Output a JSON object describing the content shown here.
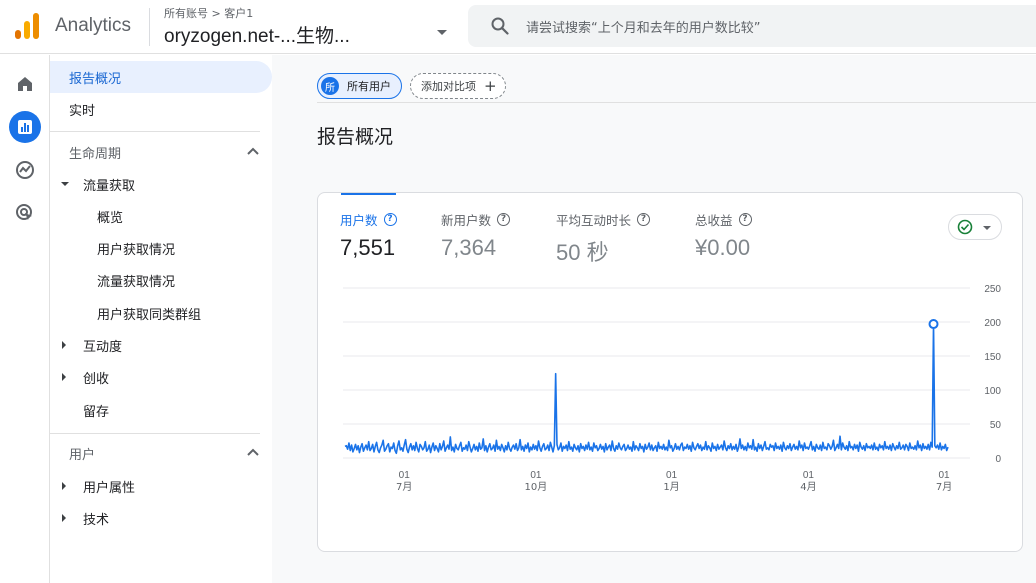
{
  "header": {
    "app_name": "Analytics",
    "breadcrumb": "所有账号 > 客户1",
    "property": "oryzogen.net-...生物...",
    "search_placeholder": "请尝试搜索“上个月和去年的用户数比较”"
  },
  "rail": {
    "items": [
      {
        "icon": "home-icon",
        "active": false
      },
      {
        "icon": "reports-icon",
        "active": true
      },
      {
        "icon": "explore-icon",
        "active": false
      },
      {
        "icon": "advertising-icon",
        "active": false
      }
    ]
  },
  "nav": {
    "overview": "报告概况",
    "realtime": "实时",
    "lifecycle": "生命周期",
    "acquisition": "流量获取",
    "acq_overview": "概览",
    "user_acquisition": "用户获取情况",
    "traffic_acquisition": "流量获取情况",
    "cohort": "用户获取同类群组",
    "engagement": "互动度",
    "monetization": "创收",
    "retention": "留存",
    "user": "用户",
    "user_attributes": "用户属性",
    "tech": "技术"
  },
  "main": {
    "chip_all_avatar": "所",
    "chip_all": "所有用户",
    "chip_add": "添加对比项",
    "chip_add_icon": "+",
    "page_title": "报告概况",
    "help_glyph": "?",
    "metrics": [
      {
        "label": "用户数",
        "value": "7,551"
      },
      {
        "label": "新用户数",
        "value": "7,364"
      },
      {
        "label": "平均互动时长",
        "value": "50 秒"
      },
      {
        "label": "总收益",
        "value": "¥0.00"
      }
    ]
  },
  "colors": {
    "accent": "#1a73e8",
    "line": "#1a73e8",
    "check": "#188038"
  },
  "chart_data": {
    "type": "line",
    "y_ticks": [
      "250",
      "200",
      "150",
      "100",
      "50",
      "0"
    ],
    "ylim": [
      0,
      250
    ],
    "x_ticks": [
      {
        "day": "01",
        "month": "7月"
      },
      {
        "day": "01",
        "month": "10月"
      },
      {
        "day": "01",
        "month": "1月"
      },
      {
        "day": "01",
        "month": "4月"
      },
      {
        "day": "01",
        "month": "7月"
      }
    ],
    "series": [
      {
        "values": [
          17,
          18,
          13,
          22,
          11,
          19,
          9,
          14,
          20,
          12,
          18,
          8,
          16,
          21,
          10,
          15,
          19,
          12,
          24,
          11,
          14,
          20,
          9,
          17,
          23,
          12,
          8,
          15,
          19,
          26,
          10,
          13,
          18,
          21,
          9,
          16,
          14,
          22,
          11,
          7,
          18,
          25,
          12,
          15,
          10,
          19,
          27,
          13,
          8,
          16,
          21,
          12,
          18,
          11,
          23,
          14,
          9,
          20,
          17,
          12,
          15,
          24,
          10,
          13,
          19,
          8,
          16,
          22,
          11,
          18,
          14,
          9,
          21,
          12,
          17,
          25,
          10,
          15,
          19,
          13,
          31,
          11,
          16,
          9,
          20,
          14,
          12,
          18,
          23,
          10,
          15,
          13,
          19,
          11,
          24,
          16,
          9,
          14,
          20,
          12,
          17,
          10,
          22,
          13,
          15,
          28,
          11,
          18,
          9,
          16,
          21,
          12,
          14,
          19,
          10,
          26,
          13,
          17,
          11,
          20,
          15,
          9,
          18,
          12,
          23,
          14,
          10,
          16,
          19,
          13,
          21,
          11,
          15,
          27,
          12,
          17,
          10,
          19,
          14,
          22,
          9,
          16,
          12,
          20,
          13,
          18,
          11,
          25,
          15,
          10,
          17,
          21,
          12,
          14,
          19,
          11,
          23,
          16,
          9,
          18,
          13,
          20,
          12,
          15,
          22,
          10,
          17,
          14,
          19,
          11,
          24,
          13,
          16,
          10,
          20,
          15,
          12,
          18,
          9,
          21,
          14,
          17,
          11,
          19,
          13,
          23,
          12,
          16,
          10,
          22,
          15,
          18,
          11,
          14,
          20,
          13,
          17,
          9,
          21,
          12,
          16,
          19,
          11,
          25,
          14,
          10,
          18,
          13,
          22,
          15,
          12,
          17,
          20,
          11,
          14,
          19,
          13,
          16,
          10,
          24,
          12,
          18,
          15,
          11,
          21,
          14,
          17,
          9,
          20,
          13,
          16,
          22,
          12,
          19,
          11,
          15,
          18,
          10,
          23,
          14,
          17,
          13,
          20,
          12,
          16,
          11,
          26,
          15,
          18,
          10,
          14,
          21,
          13,
          17,
          12,
          19,
          22,
          11,
          16,
          14,
          20,
          13,
          18,
          10,
          23,
          15,
          12,
          17,
          21,
          14,
          19,
          11,
          16,
          13,
          24,
          12,
          18,
          15,
          10,
          22,
          14,
          17,
          11,
          20,
          13,
          16,
          19,
          12,
          25,
          15,
          11,
          18,
          14,
          21,
          12,
          17,
          13,
          20,
          10,
          16,
          23,
          14,
          19,
          12,
          17,
          11,
          22,
          15,
          18,
          13,
          27,
          12,
          16,
          10,
          21,
          14,
          19,
          11,
          17,
          24,
          13,
          15,
          12,
          20,
          16,
          18,
          11,
          22,
          14,
          17,
          13,
          19,
          10,
          23,
          15,
          12,
          18,
          14,
          21,
          11,
          16,
          20,
          13,
          17,
          12,
          25,
          15,
          19,
          11,
          22,
          14,
          16,
          13,
          18,
          24,
          12,
          17,
          10,
          20,
          15,
          13,
          19,
          11,
          23,
          14,
          16,
          12,
          21,
          18,
          13,
          17,
          26,
          11,
          15,
          20,
          14,
          19,
          12,
          22,
          16,
          13,
          18,
          11,
          24,
          15,
          17,
          12,
          20,
          14,
          19,
          10,
          23,
          16,
          13,
          18,
          11,
          21,
          15,
          17,
          14,
          19,
          12,
          22,
          13,
          16,
          11,
          20,
          15,
          18,
          12,
          24,
          14,
          17,
          13,
          19,
          11,
          21,
          16,
          12,
          18,
          14,
          23,
          13,
          15,
          19,
          12,
          20,
          17,
          11,
          22,
          14,
          16,
          13,
          18,
          12,
          25,
          15,
          19,
          11,
          21,
          14,
          17,
          13,
          20,
          12,
          23,
          16,
          11,
          18,
          15,
          19,
          13,
          22,
          12,
          17,
          14,
          20,
          11,
          16
        ]
      }
    ],
    "spikes": [
      {
        "index": 160,
        "value": 124
      },
      {
        "index": 300,
        "value": 28
      },
      {
        "index": 376,
        "value": 32
      },
      {
        "index": 447,
        "value": 197
      }
    ],
    "highlight_index": 447
  }
}
